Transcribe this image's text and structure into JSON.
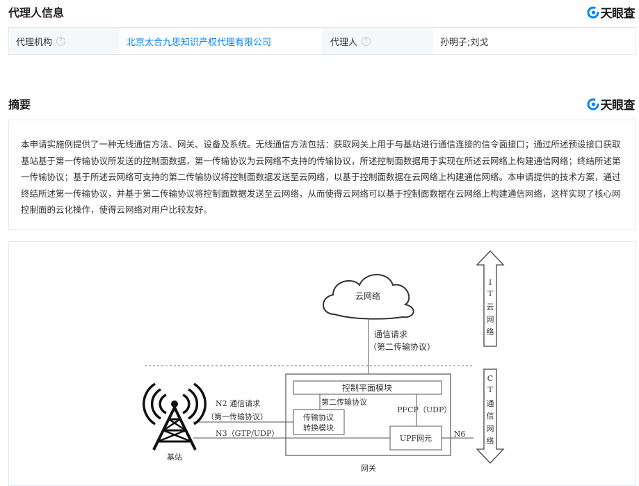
{
  "agent_section": {
    "title": "代理人信息",
    "brand": "天眼查",
    "agency_label": "代理机构",
    "agency_value": "北京太合九思知识产权代理有限公司",
    "agent_label": "代理人",
    "agent_value": "孙明子;刘戈",
    "help_glyph": "?"
  },
  "abstract_section": {
    "title": "摘要",
    "brand": "天眼查",
    "text": "本申请实施例提供了一种无线通信方法、网关、设备及系统。无线通信方法包括：获取网关上用于与基站进行通信连接的信令面接口；通过所述预设接口获取基站基于第一传输协议所发送的控制面数据，第一传输协议为云网络不支持的传输协议，所述控制面数据用于实现在所述云网络上构建通信网络；终结所述第一传输协议；基于所述云网络可支持的第二传输协议将控制面数据发送至云网络，以基于控制面数据在云网络上构建通信网络。本申请提供的技术方案，通过终结所述第一传输协议，并基于第二传输协议将控制面数据发送至云网络，从而使得云网络可以基于控制面数据在云网络上构建通信网络，这样实现了核心网控制面的云化操作，使得云网络对用户比较友好。"
  },
  "diagram": {
    "cloud": "云网络",
    "comm_request": "通信请求",
    "second_protocol_paren": "（第二传输协议）",
    "it_label": [
      "I",
      "T",
      "云",
      "网",
      "络"
    ],
    "ct_label": [
      "C",
      "T",
      "通",
      "信",
      "网",
      "络"
    ],
    "control_plane": "控制平面模块",
    "second_protocol": "第二传输协议",
    "pfcp": "PFCP（UDP）",
    "converter_line1": "传输协议",
    "converter_line2": "转换模块",
    "n2": "N2 通信请求",
    "first_protocol_paren": "（第一传输协议）",
    "n3": "N3（GTP/UDP）",
    "upf": "UPF网元",
    "n6": "N6",
    "base_station": "基站",
    "gateway": "网关"
  },
  "icons": {
    "help": "question-circle-icon",
    "brand": "tianyancha-logo-icon",
    "antenna": "antenna-tower-icon"
  },
  "colors": {
    "link": "#0084ff",
    "label_bg": "#f4f8fb",
    "border": "#e4e9ee",
    "brand_blue": "#0084ff"
  }
}
